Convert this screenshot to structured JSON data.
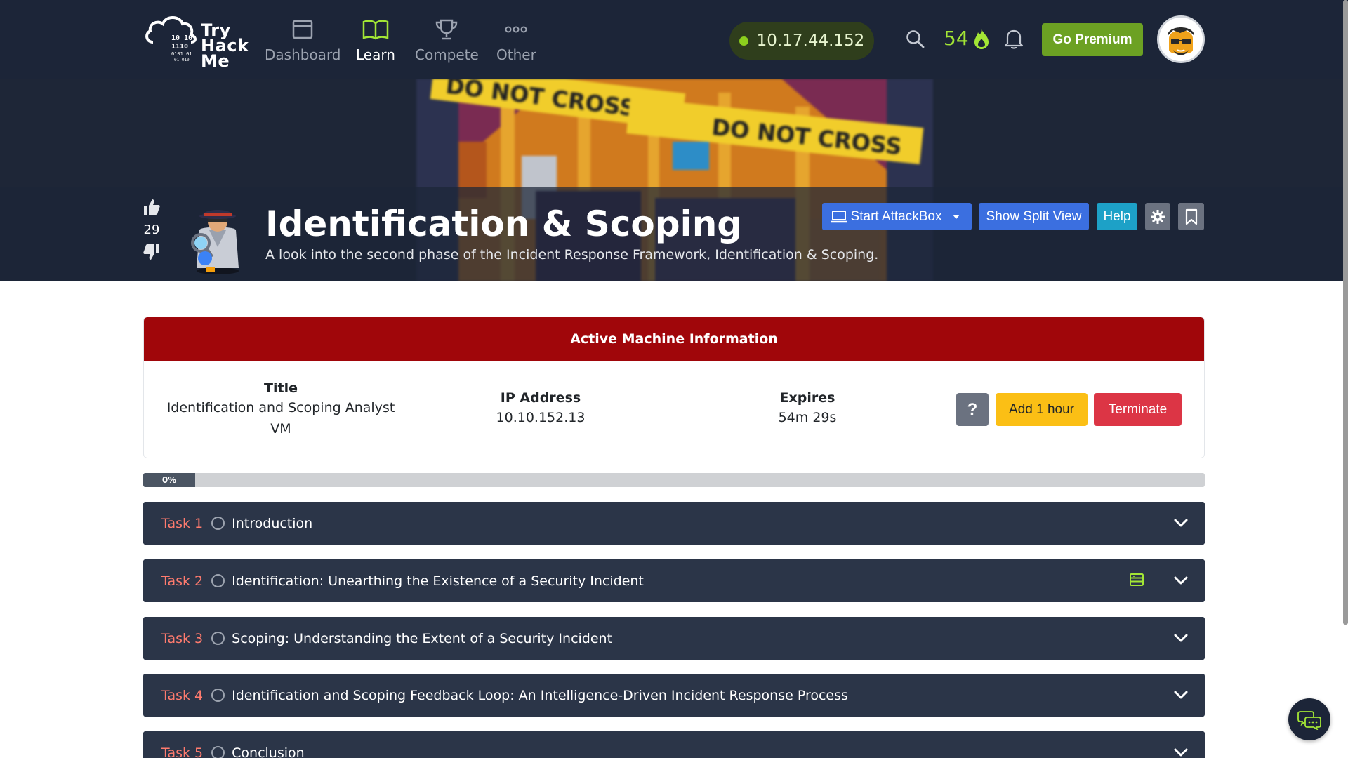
{
  "nav": {
    "logo": [
      "Try",
      "Hack",
      "Me"
    ],
    "items": [
      {
        "label": "Dashboard",
        "icon": "dashboard-icon"
      },
      {
        "label": "Learn",
        "icon": "book-icon",
        "active": true
      },
      {
        "label": "Compete",
        "icon": "trophy-icon"
      },
      {
        "label": "Other",
        "icon": "dots-icon"
      }
    ],
    "ip": "10.17.44.152",
    "streak": "54",
    "premium_label": "Go Premium",
    "colors": {
      "bg": "#1c2538",
      "accent": "#6ca123",
      "streak": "#a3e635"
    }
  },
  "hero": {
    "votes": "29",
    "title": "Identification & Scoping",
    "subtitle": "A look into the second phase of the Incident Response Framework, Identification & Scoping.",
    "banner_text": [
      "DO NOT CROSS",
      "DO NOT CROSS"
    ],
    "buttons": {
      "attackbox": "Start AttackBox",
      "split": "Show Split View",
      "help": "Help"
    }
  },
  "machine": {
    "header": "Active Machine Information",
    "title_label": "Title",
    "title_value": "Identification and Scoping Analyst VM",
    "ip_label": "IP Address",
    "ip_value": "10.10.152.13",
    "expires_label": "Expires",
    "expires_value": "54m 29s",
    "q_label": "?",
    "add_label": "Add 1 hour",
    "terminate_label": "Terminate",
    "colors": {
      "header": "#a0060a",
      "add": "#fbbf15",
      "terminate": "#dc3545"
    }
  },
  "progress": {
    "label": "0%",
    "value": 0
  },
  "tasks": [
    {
      "num": "Task 1",
      "title": "Introduction",
      "has_doc": false
    },
    {
      "num": "Task 2",
      "title": "Identification: Unearthing the Existence of a Security Incident",
      "has_doc": true
    },
    {
      "num": "Task 3",
      "title": "Scoping: Understanding the Extent of a Security Incident",
      "has_doc": false
    },
    {
      "num": "Task 4",
      "title": "Identification and Scoping Feedback Loop: An Intelligence-Driven Incident Response Process",
      "has_doc": false
    },
    {
      "num": "Task 5",
      "title": "Conclusion",
      "has_doc": false
    }
  ]
}
